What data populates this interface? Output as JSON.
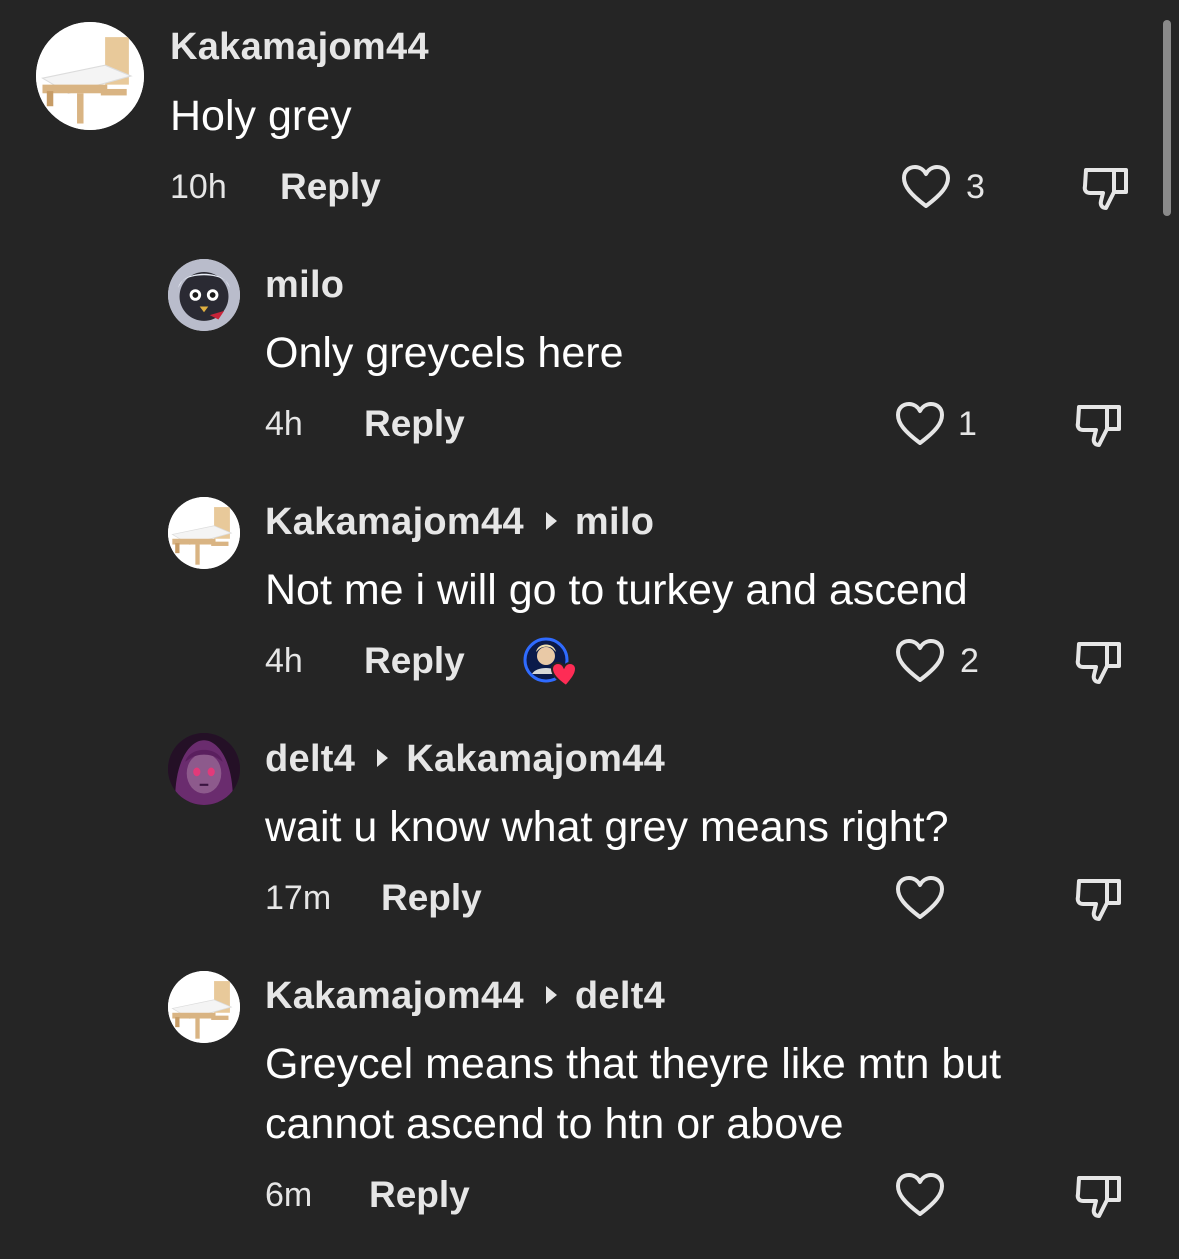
{
  "comments": [
    {
      "username": "Kakamajom44",
      "reply_to": "",
      "avatar_icon": "bed-icon",
      "text": "Holy grey",
      "time": "10h",
      "reply_label": "Reply",
      "likes": "3"
    },
    {
      "username": "milo",
      "reply_to": "",
      "avatar_icon": "anime-character-avatar",
      "text": "Only greycels here",
      "time": "4h",
      "reply_label": "Reply",
      "likes": "1"
    },
    {
      "username": "Kakamajom44",
      "reply_to": "milo",
      "avatar_icon": "bed-icon",
      "text": "Not me i will go to turkey and ascend",
      "time": "4h",
      "reply_label": "Reply",
      "likes": "2",
      "creator_liked": true
    },
    {
      "username": "delt4",
      "reply_to": "Kakamajom44",
      "avatar_icon": "purple-anime-avatar",
      "text": "wait u know what grey means right?",
      "time": "17m",
      "reply_label": "Reply",
      "likes": ""
    },
    {
      "username": "Kakamajom44",
      "reply_to": "delt4",
      "avatar_icon": "bed-icon",
      "text": "Greycel means that theyre like mtn but cannot ascend to htn or above",
      "time": "6m",
      "reply_label": "Reply",
      "likes": ""
    }
  ],
  "icons": {
    "like": "heart-outline-icon",
    "dislike": "thumbs-down-icon",
    "reply_arrow": "triangle-right-icon"
  },
  "colors": {
    "background": "#252525",
    "text": "#ffffff",
    "secondary_text": "#e6e6e6",
    "creator_heart": "#fe2c55"
  }
}
